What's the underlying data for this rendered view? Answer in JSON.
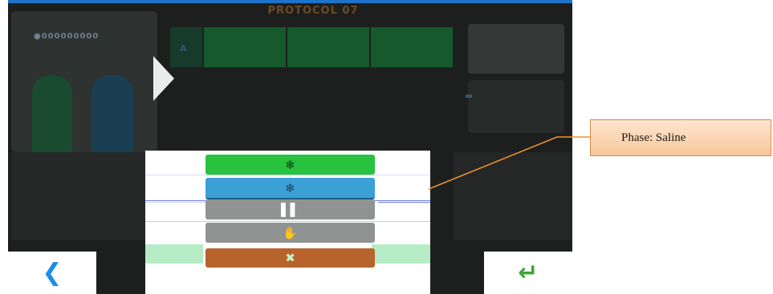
{
  "screen": {
    "title": "PROTOCOL 07",
    "device_label": "●000000000",
    "phase_label": "A",
    "phases": [
      "",
      "",
      ""
    ]
  },
  "phase_menu": {
    "options": [
      {
        "name": "contrast",
        "glyph": "❄",
        "color": "#27c23e"
      },
      {
        "name": "saline",
        "glyph": "❄",
        "color": "#3aa0d6"
      },
      {
        "name": "pause",
        "glyph": "▌▌",
        "color": "#8f9492"
      },
      {
        "name": "hold",
        "glyph": "✋",
        "color": "#8f9492"
      },
      {
        "name": "delete",
        "glyph": "✖",
        "color": "#b8632c"
      }
    ]
  },
  "footer": {
    "back_glyph": "❮",
    "enter_glyph": "↵"
  },
  "callout": {
    "text": "Phase: Saline"
  }
}
